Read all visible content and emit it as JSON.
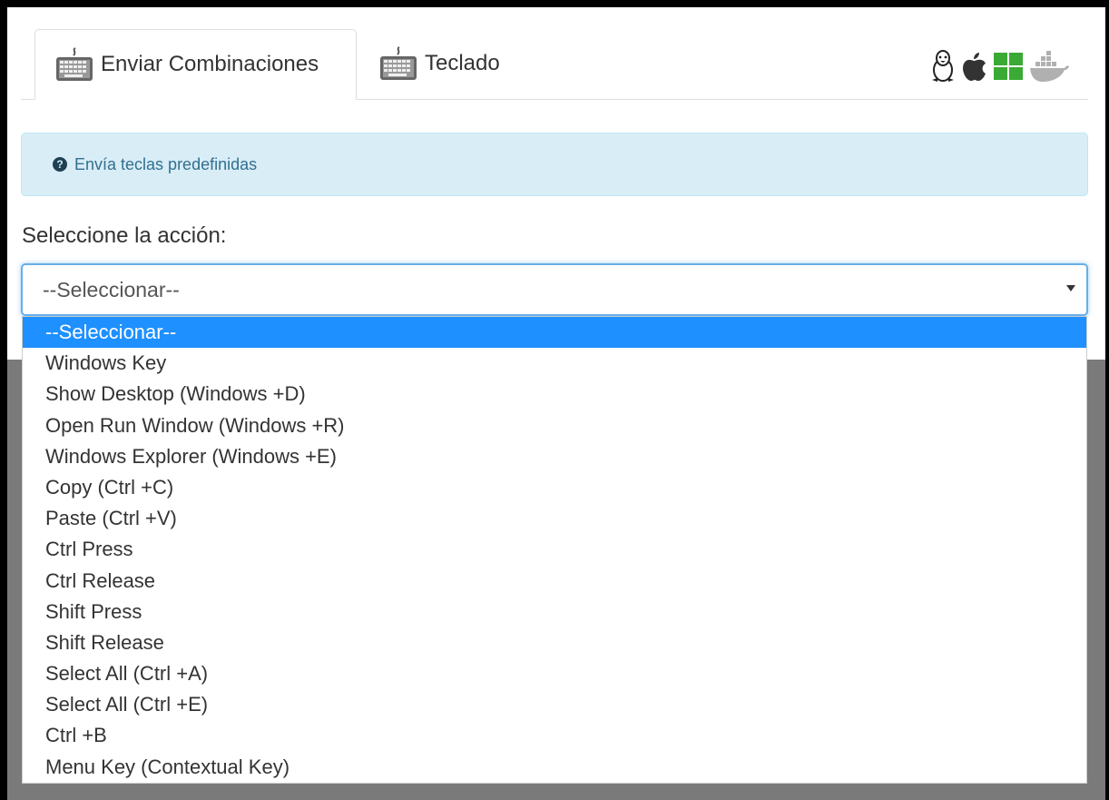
{
  "tabs": [
    {
      "label": "Enviar Combinaciones",
      "active": true
    },
    {
      "label": "Teclado",
      "active": false
    }
  ],
  "os_icons": [
    "linux-icon",
    "apple-icon",
    "windows-icon",
    "docker-icon"
  ],
  "alert": {
    "text": "Envía teclas predefinidas"
  },
  "form": {
    "label": "Seleccione la acción:",
    "selected": "--Seleccionar--"
  },
  "options": [
    "--Seleccionar--",
    "Windows Key",
    "Show Desktop (Windows +D)",
    "Open Run Window (Windows +R)",
    "Windows Explorer (Windows +E)",
    "Copy (Ctrl +C)",
    "Paste (Ctrl +V)",
    "Ctrl Press",
    "Ctrl Release",
    "Shift Press",
    "Shift Release",
    "Select All (Ctrl +A)",
    "Select All (Ctrl +E)",
    "Ctrl +B",
    "Menu Key (Contextual Key)"
  ],
  "colors": {
    "highlight": "#1e90ff",
    "alert_bg": "#d9edf7",
    "windows_green": "#3aaa35",
    "docker_gray": "#b0b0b0"
  }
}
